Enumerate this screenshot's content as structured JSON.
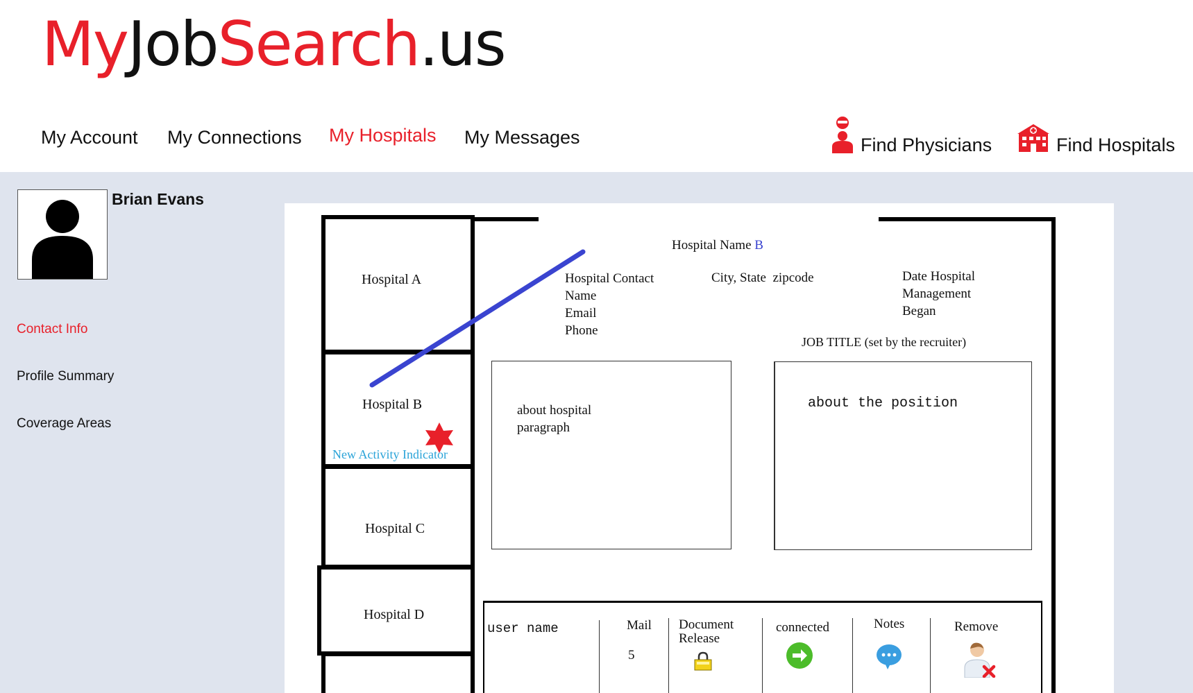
{
  "logo": {
    "part1": "My",
    "part2": "Job",
    "part3": "Search",
    "part4": ".us"
  },
  "nav": {
    "items": [
      {
        "label": "My Account"
      },
      {
        "label": "My Connections"
      },
      {
        "label": "My Hospitals",
        "active": true
      },
      {
        "label": "My Messages"
      }
    ],
    "find_physicians": {
      "label": "Find Physicians",
      "icon": "doctor-icon"
    },
    "find_hospitals": {
      "label": "Find Hospitals",
      "icon": "hospital-icon"
    }
  },
  "colors": {
    "brand_red": "#e8202a",
    "content_bg": "#dfe4ee",
    "link_blue": "#29a3d8",
    "strike_blue": "#3a44d0"
  },
  "profile": {
    "name": "Brian Evans",
    "avatar_icon": "user-silhouette-icon"
  },
  "sidebar": {
    "items": [
      {
        "label": "Contact Info",
        "active": true
      },
      {
        "label": "Profile Summary"
      },
      {
        "label": "Coverage Areas"
      }
    ]
  },
  "mockup": {
    "hospitals": [
      {
        "label": "Hospital A"
      },
      {
        "label": "Hospital B"
      },
      {
        "label": "Hospital C"
      },
      {
        "label": "Hospital D"
      }
    ],
    "new_activity": "New Activity Indicator",
    "hospital_name_label": "Hospital Name",
    "hospital_name_value": "B",
    "contact_lines": [
      "Hospital Contact",
      "Name",
      "Email",
      "Phone"
    ],
    "city_state": "City, State  zipcode",
    "date_lines": [
      "Date Hospital",
      "Management",
      "Began"
    ],
    "job_title": "JOB TITLE (set by the recruiter)",
    "about_hospital_lines": [
      "about hospital",
      "paragraph"
    ],
    "about_position": "about the position",
    "connection_bar": {
      "user_name": "user name",
      "mail_label": "Mail",
      "mail_count": "5",
      "document_lines": [
        "Document",
        "Release"
      ],
      "connected_label": "connected",
      "notes_label": "Notes",
      "remove_label": "Remove"
    }
  }
}
